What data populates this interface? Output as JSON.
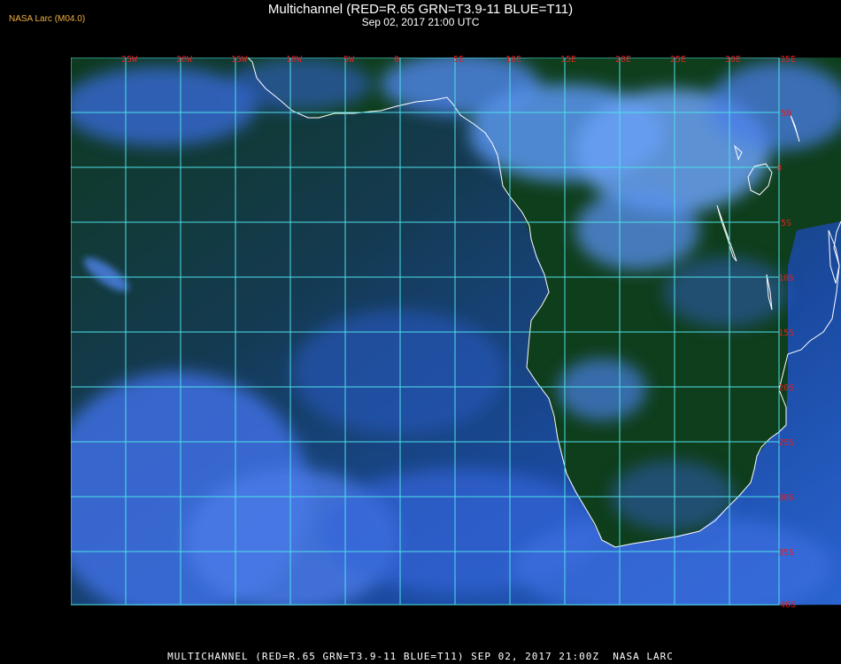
{
  "header": {
    "credit": "NASA Larc (M04.0)",
    "title": "Multichannel (RED=R.65 GRN=T3.9-11 BLUE=T11)",
    "subtitle": "Sep 02, 2017 21:00 UTC"
  },
  "footer": {
    "text": "MULTICHANNEL (RED=R.65 GRN=T3.9-11 BLUE=T11) SEP 02, 2017 21:00Z  NASA LARC"
  },
  "colors": {
    "grid": "#4fe0e8",
    "label": "#e02020",
    "coast": "#ffffff",
    "ocean": "#1a3f8a",
    "land": "#0f3a18",
    "cloud": "#5a8ef0"
  },
  "map": {
    "lon_labels": [
      "25W",
      "20W",
      "15W",
      "10W",
      "5W",
      "0",
      "5E",
      "10E",
      "15E",
      "20E",
      "25E",
      "30E",
      "35E"
    ],
    "lat_labels": [
      "5N",
      "0",
      "5S",
      "10S",
      "15S",
      "20S",
      "25S",
      "30S",
      "35S",
      "40S"
    ]
  }
}
